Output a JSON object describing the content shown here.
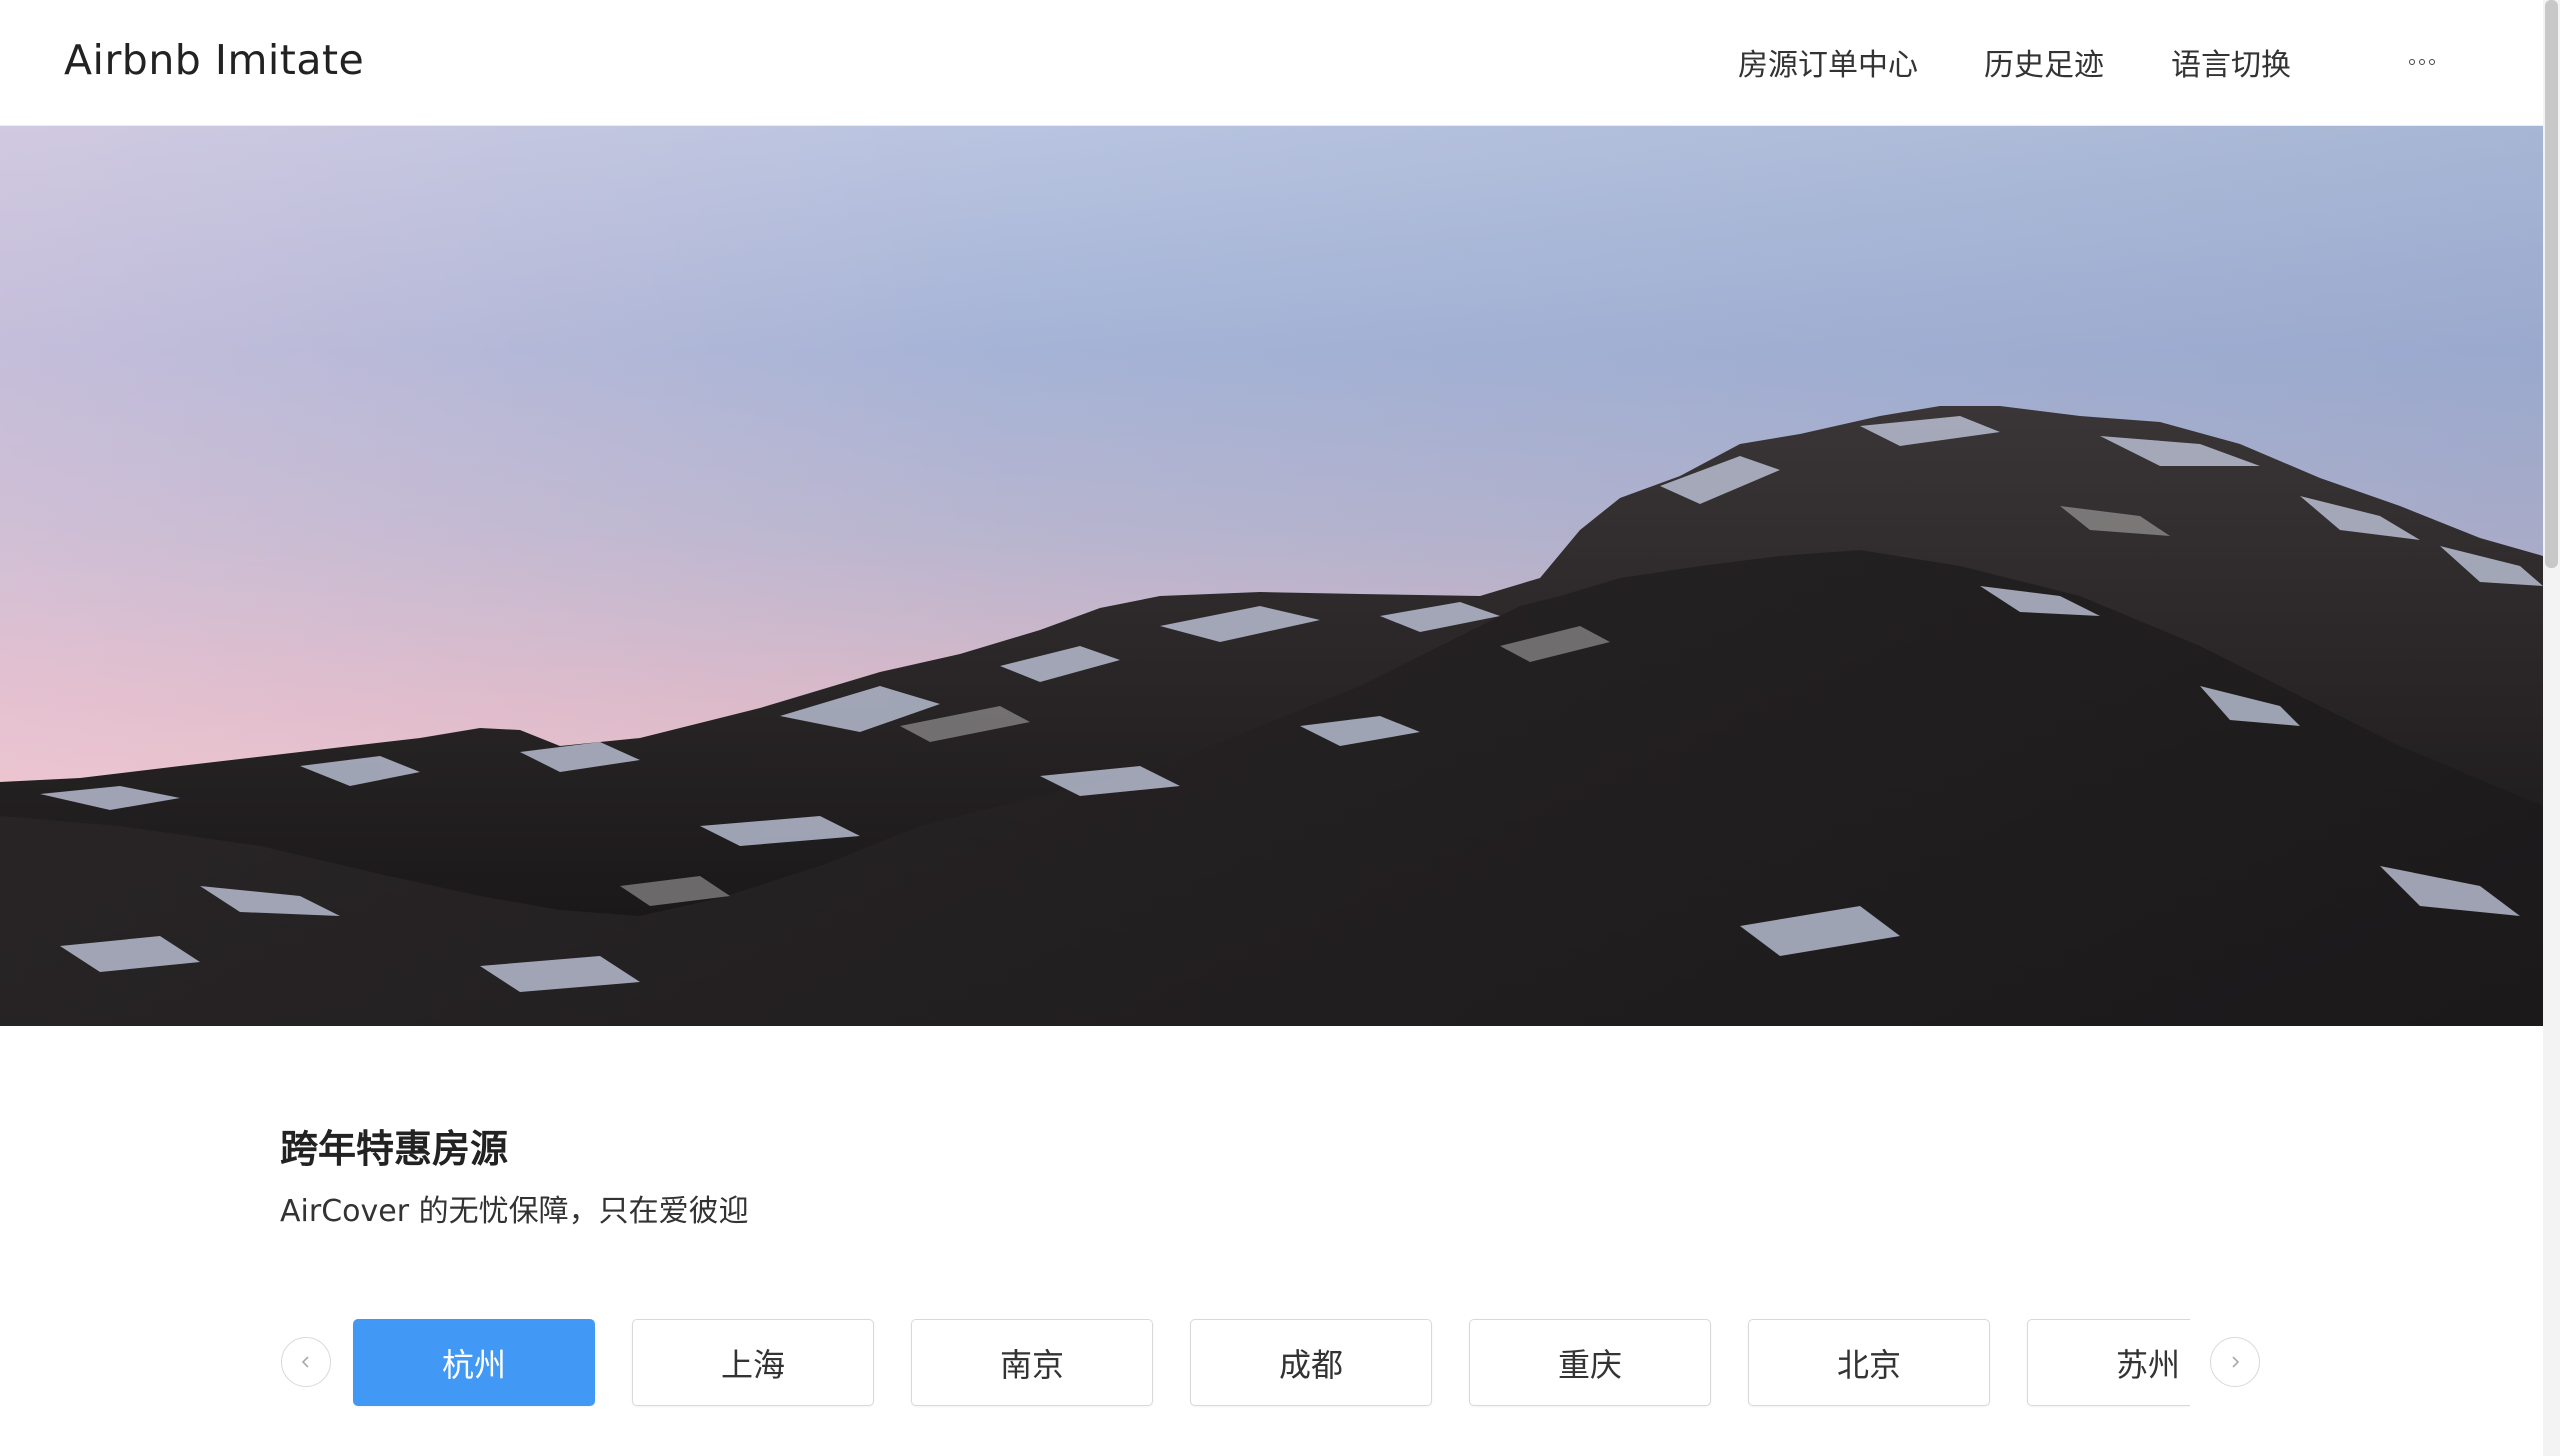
{
  "header": {
    "brand": "Airbnb Imitate",
    "nav": {
      "orders": "房源订单中心",
      "history": "历史足迹",
      "language": "语言切换"
    }
  },
  "hero": {
    "description": "mountain landscape at dusk"
  },
  "section": {
    "title": "跨年特惠房源",
    "subtitle": "AirCover 的无忧保障，只在爱彼迎"
  },
  "tabs": {
    "items": [
      "杭州",
      "上海",
      "南京",
      "成都",
      "重庆",
      "北京",
      "苏州"
    ],
    "active": "杭州"
  },
  "icons": {
    "more": "more-dots-icon",
    "prev": "chevron-left-icon",
    "next": "chevron-right-icon"
  },
  "colors": {
    "accent": "#4299f5"
  }
}
